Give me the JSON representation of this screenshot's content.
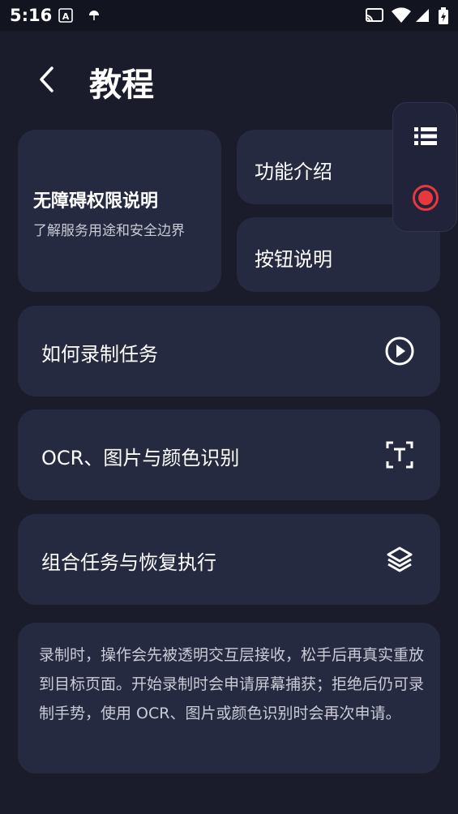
{
  "status_bar": {
    "time": "5:16"
  },
  "header": {
    "title": "教程"
  },
  "cards": {
    "permission": {
      "title": "无障碍权限说明",
      "subtitle": "了解服务用途和安全边界"
    },
    "features": {
      "label": "功能介绍"
    },
    "buttons": {
      "label": "按钮说明"
    }
  },
  "rows": [
    {
      "label": "如何录制任务",
      "icon": "play-circle-icon"
    },
    {
      "label": "OCR、图片与颜色识别",
      "icon": "text-recognition-icon"
    },
    {
      "label": "组合任务与恢复执行",
      "icon": "layers-icon"
    }
  ],
  "note": {
    "text": "录制时，操作会先被透明交互层接收，松手后再真实重放到目标页面。开始录制时会申请屏幕捕获；拒绝后仍可录制手势，使用 OCR、图片或颜色识别时会再次申请。"
  },
  "floating_panel": {
    "items": [
      "list-icon",
      "record-icon"
    ]
  },
  "colors": {
    "background": "#1a1c2c",
    "card": "#262a40",
    "record_red": "#e8383d"
  }
}
